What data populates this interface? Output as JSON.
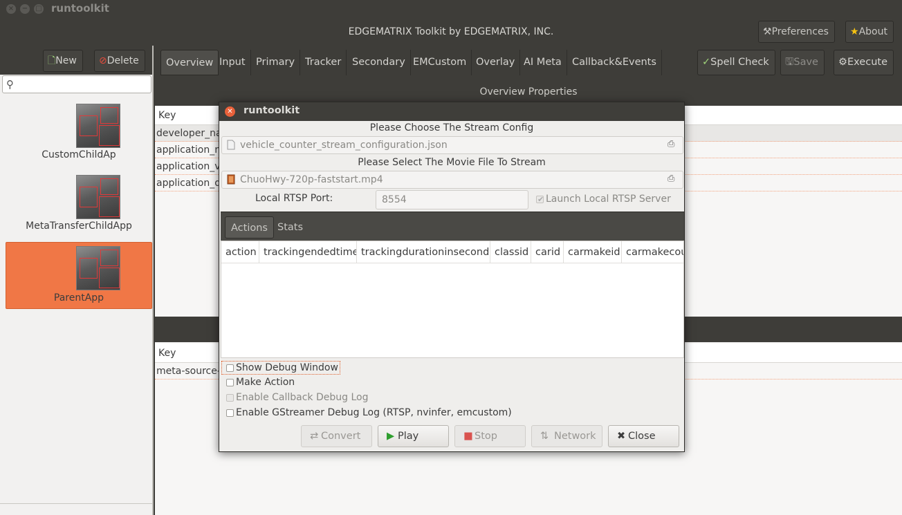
{
  "window": {
    "title": "runtoolkit",
    "header_title": "EDGEMATRIX Toolkit by EDGEMATRIX, INC."
  },
  "header": {
    "preferences_label": "Preferences",
    "about_label": "About"
  },
  "sidebar": {
    "new_label": "New",
    "delete_label": "Delete",
    "search_placeholder": "",
    "apps": [
      {
        "label": "CustomChildAp"
      },
      {
        "label": "MetaTransferChildApp"
      },
      {
        "label": "ParentApp"
      }
    ]
  },
  "tabs": [
    "Overview",
    "Input",
    "Primary",
    "Tracker",
    "Secondary",
    "EMCustom",
    "Overlay",
    "AI Meta",
    "Callback&Events"
  ],
  "toolbar": {
    "spell_check_label": "Spell Check",
    "save_label": "Save",
    "execute_label": "Execute"
  },
  "overview": {
    "section_title": "Overview Properties",
    "key_header": "Key",
    "rows": [
      "developer_na",
      "application_n",
      "application_v",
      "application_d"
    ]
  },
  "lower": {
    "key_header": "Key",
    "rows": [
      "meta-source-"
    ]
  },
  "dialog": {
    "title": "runtoolkit",
    "stream_config_label": "Please Choose The Stream Config",
    "stream_config_file": "vehicle_counter_stream_configuration.json",
    "movie_label": "Please Select The Movie File To Stream",
    "movie_file": "ChuoHwy-720p-faststart.mp4",
    "rtsp_port_label": "Local RTSP Port:",
    "rtsp_port_value": "8554",
    "launch_rtsp_label": "Launch Local RTSP Server",
    "stack_tabs": [
      "Actions",
      "Stats"
    ],
    "columns": [
      "action",
      "trackingendedtime",
      "trackingdurationinseconds",
      "classid",
      "carid",
      "carmakeid",
      "carmakecou"
    ],
    "options": {
      "show_debug": "Show Debug Window",
      "make_action": "Make Action",
      "callback_debug": "Enable Callback Debug Log",
      "gstreamer_debug": "Enable GStreamer Debug Log (RTSP, nvinfer, emcustom)"
    },
    "buttons": {
      "convert": "Convert",
      "play": "Play",
      "stop": "Stop",
      "network": "Network",
      "close": "Close"
    }
  }
}
